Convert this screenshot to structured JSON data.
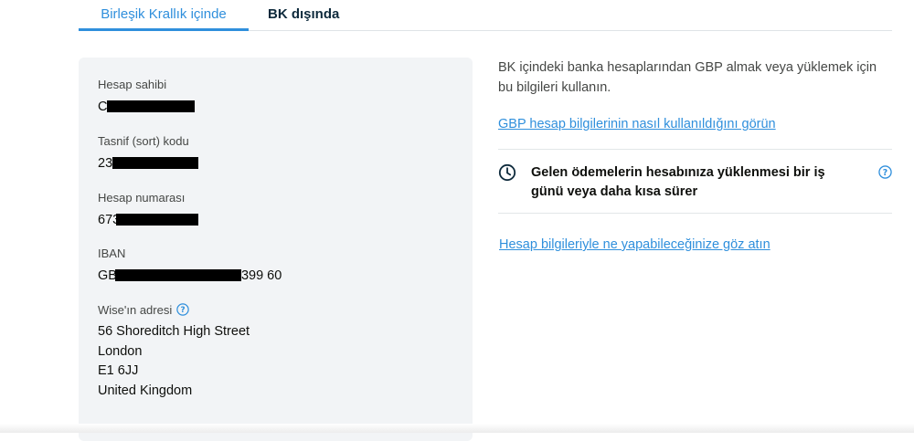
{
  "tabs": {
    "active": "Birleşik Krallık içinde",
    "inactive": "BK dışında"
  },
  "account": {
    "holder_label": "Hesap sahibi",
    "holder_value_prefix": "C",
    "sort_label": "Tasnif (sort) kodu",
    "sort_value_prefix": "23",
    "number_label": "Hesap numarası",
    "number_value_prefix": "673",
    "iban_label": "IBAN",
    "iban_value_prefix": "GB",
    "iban_value_suffix": "399 60",
    "address_label": "Wise'ın adresi",
    "address_lines": [
      "56 Shoreditch High Street",
      "London",
      "E1 6JJ",
      "United Kingdom"
    ]
  },
  "info": {
    "intro": "BK içindeki banka hesaplarından GBP almak veya yüklemek için bu bilgileri kullanın.",
    "usage_link": "GBP hesap bilgilerinin nasıl kullanıldığını görün",
    "notice": "Gelen ödemelerin hesabınıza yüklenmesi bir iş günü veya daha kısa sürer",
    "actions_link": "Hesap bilgileriyle ne yapabileceğinize göz atın"
  },
  "colors": {
    "accent": "#2f8fdc",
    "card_bg": "#f2f4f6",
    "redaction": "#000000"
  },
  "icons": [
    "help-icon",
    "clock-icon"
  ]
}
